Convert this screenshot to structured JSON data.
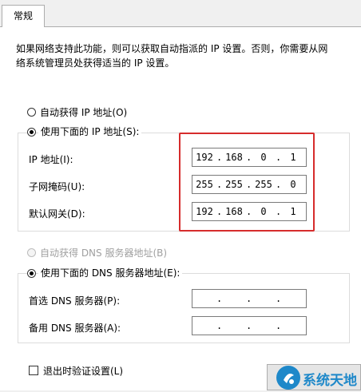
{
  "tab": {
    "label": "常规"
  },
  "description": "如果网络支持此功能，则可以获取自动指派的 IP 设置。否则，你需要从网络系统管理员处获得适当的 IP 设置。",
  "ip_mode": {
    "auto_label": "自动获得 IP 地址(O)",
    "manual_label": "使用下面的 IP 地址(S):",
    "selected": "manual"
  },
  "ip_fields": {
    "ip_label": "IP 地址(I):",
    "ip_value": [
      "192",
      "168",
      "0",
      "1"
    ],
    "mask_label": "子网掩码(U):",
    "mask_value": [
      "255",
      "255",
      "255",
      "0"
    ],
    "gateway_label": "默认网关(D):",
    "gateway_value": [
      "192",
      "168",
      "0",
      "1"
    ]
  },
  "dns_mode": {
    "auto_label": "自动获得 DNS 服务器地址(B)",
    "manual_label": "使用下面的 DNS 服务器地址(E):",
    "selected": "manual"
  },
  "dns_fields": {
    "preferred_label": "首选 DNS 服务器(P):",
    "preferred_value": [
      "",
      "",
      "",
      ""
    ],
    "alternate_label": "备用 DNS 服务器(A):",
    "alternate_value": [
      "",
      "",
      "",
      ""
    ]
  },
  "validate": {
    "label": "退出时验证设置(L)",
    "checked": false
  },
  "watermark": {
    "text": "系统天地"
  },
  "colors": {
    "highlight": "#d62c2c",
    "watermark": "#1e88c9"
  }
}
